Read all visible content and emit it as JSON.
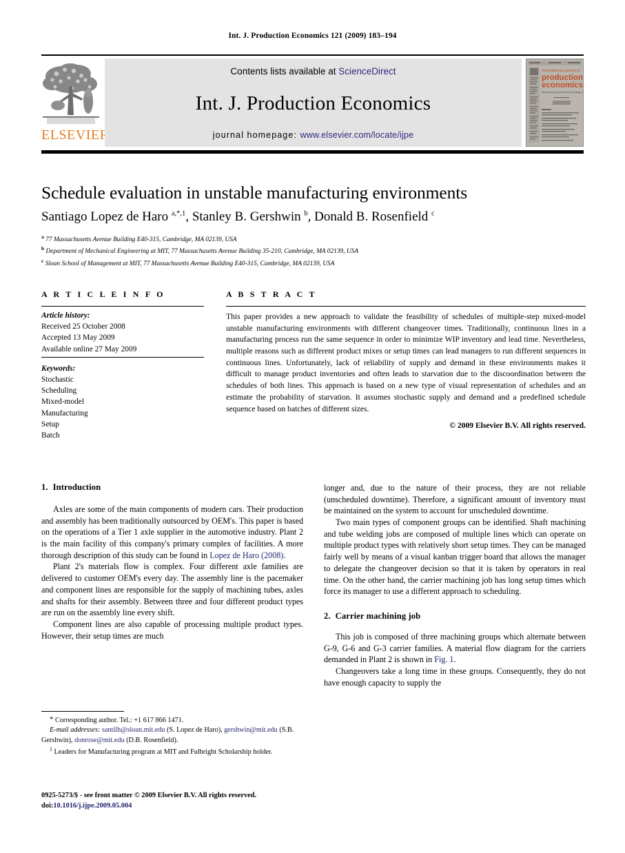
{
  "running_head": "Int. J. Production Economics 121 (2009) 183–194",
  "masthead": {
    "publisher_name": "ELSEVIER",
    "contents_prefix": "Contents lists available at ",
    "contents_link": "ScienceDirect",
    "journal_title": "Int. J. Production Economics",
    "homepage_prefix": "journal homepage: ",
    "homepage_link": "www.elsevier.com/locate/ijpe",
    "cover": {
      "line1": "International journal of",
      "line2": "production",
      "line3": "economics",
      "line4": "Manufacturing Business Strategy & Design",
      "accent_color": "#c0502a",
      "background_color": "#b9b5ae"
    }
  },
  "article": {
    "title": "Schedule evaluation in unstable manufacturing environments",
    "authors_html": "Santiago Lopez de Haro <sup>a,*,1</sup>, Stanley B. Gershwin <sup>b</sup>, Donald B. Rosenfield <sup>c</sup>",
    "affiliations": [
      {
        "marker": "a",
        "text": "77 Massachusetts Avenue Building E40-315, Cambridge, MA 02139, USA"
      },
      {
        "marker": "b",
        "text": "Department of Mechanical Engineering at MIT, 77 Massachusetts Avenue Building 35-210, Cambridge, MA 02139, USA"
      },
      {
        "marker": "c",
        "text": "Sloan School of Management at MIT, 77 Massachusetts Avenue Building E40-315, Cambridge, MA 02139, USA"
      }
    ]
  },
  "article_info": {
    "heading": "A R T I C L E   I N F O",
    "history_label": "Article history:",
    "history": [
      "Received 25 October 2008",
      "Accepted 13 May 2009",
      "Available online 27 May 2009"
    ],
    "keywords_label": "Keywords:",
    "keywords": [
      "Stochastic",
      "Scheduling",
      "Mixed-model",
      "Manufacturing",
      "Setup",
      "Batch"
    ]
  },
  "abstract": {
    "heading": "A B S T R A C T",
    "text": "This paper provides a new approach to validate the feasibility of schedules of multiple-step mixed-model unstable manufacturing environments with different changeover times. Traditionally, continuous lines in a manufacturing process run the same sequence in order to minimize WIP inventory and lead time. Nevertheless, multiple reasons such as different product mixes or setup times can lead managers to run different sequences in continuous lines. Unfortunately, lack of reliability of supply and demand in these environments makes it difficult to manage product inventories and often leads to starvation due to the discoordination between the schedules of both lines. This approach is based on a new type of visual representation of schedules and an estimate the probability of starvation. It assumes stochastic supply and demand and a predefined schedule sequence based on batches of different sizes.",
    "rights": "© 2009 Elsevier B.V. All rights reserved."
  },
  "sections": {
    "introduction": {
      "number": "1.",
      "title": "Introduction",
      "paragraphs": [
        "Axles are some of the main components of modern cars. Their production and assembly has been traditionally outsourced by OEM's. This paper is based on the operations of a Tier 1 axle supplier in the automotive industry. Plant 2 is the main facility of this company's primary complex of facilities. A more thorough description of this study can be found in ",
        "Plant 2's materials flow is complex. Four different axle families are delivered to customer OEM's every day. The assembly line is the pacemaker and component lines are responsible for the supply of machining tubes, axles and shafts for their assembly. Between three and four different product types are run on the assembly line every shift.",
        "Component lines are also capable of processing multiple product types. However, their setup times are much",
        "longer and, due to the nature of their process, they are not reliable (unscheduled downtime). Therefore, a significant amount of inventory must be maintained on the system to account for unscheduled downtime.",
        "Two main types of component groups can be identified. Shaft machining and tube welding jobs are composed of multiple lines which can operate on multiple product types with relatively short setup times. They can be managed fairly well by means of a visual kanban trigger board that allows the manager to delegate the changeover decision so that it is taken by operators in real time. On the other hand, the carrier machining job has long setup times which force its manager to use a different approach to scheduling."
      ],
      "inline_reference": "Lopez de Haro (2008)",
      "reference_suffix": "."
    },
    "carrier": {
      "number": "2.",
      "title": "Carrier machining job",
      "paragraph1_a": "This job is composed of three machining groups which alternate between G-9, G-6 and G-3 carrier families. A material flow diagram for the carriers demanded in Plant 2 is shown in ",
      "figure_link": "Fig. 1",
      "paragraph1_b": ".",
      "paragraph2": "Changeovers take a long time in these groups. Consequently, they do not have enough capacity to supply the"
    }
  },
  "footnotes": {
    "corresponding": "Corresponding author. Tel.: +1 617 866 1471.",
    "email_label": "E-mail addresses:",
    "emails": [
      {
        "address": "santilh@sloan.mit.edu",
        "owner": "(S. Lopez de Haro),"
      },
      {
        "address": "gershwin@mit.edu",
        "owner": "(S.B. Gershwin),"
      },
      {
        "address": "donrose@mit.edu",
        "owner": "(D.B. Rosenfield)."
      }
    ],
    "note1_marker": "1",
    "note1": "Leaders for Manufacturing program at MIT and Fulbright Scholarship holder."
  },
  "imprint": {
    "issn_line": "0925-5273/$ - see front matter © 2009 Elsevier B.V. All rights reserved.",
    "doi_label": "doi:",
    "doi_value": "10.1016/j.ijpe.2009.05.004"
  },
  "colors": {
    "link": "#2a2a7c",
    "reference_link": "#262673",
    "elsevier_orange": "#E87B22",
    "banner_background": "#e3e3e3"
  }
}
